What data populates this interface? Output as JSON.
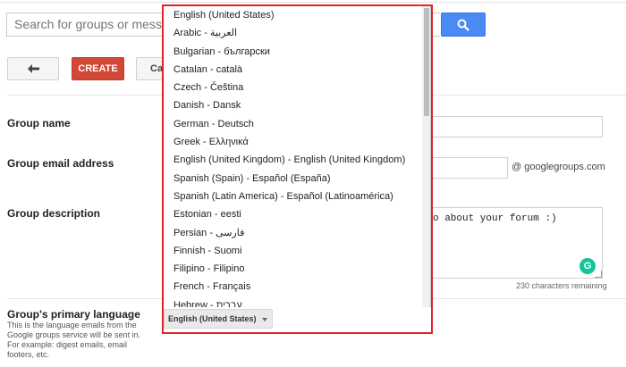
{
  "search": {
    "placeholder": "Search for groups or messag"
  },
  "toolbar": {
    "create_label": "CREATE",
    "cancel_label": "Cancel"
  },
  "form": {
    "name_label": "Group name",
    "email_label": "Group email address",
    "email_domain": "@ googlegroups.com",
    "description_label": "Group description",
    "description_value": "o about your forum :)",
    "char_count": "230 characters remaining",
    "language_label": "Group's primary language",
    "language_help": "This is the language emails from the Google groups service will be sent in. For example: digest emails, email footers, etc.",
    "language_selected": "English (United States)"
  },
  "language_options": [
    "English (United States)",
    "Arabic - العربية",
    "Bulgarian - български",
    "Catalan - català",
    "Czech - Čeština",
    "Danish - Dansk",
    "German - Deutsch",
    "Greek - Ελληνικά",
    "English (United Kingdom) - English (United Kingdom)",
    "Spanish (Spain) - Español (España)",
    "Spanish (Latin America) - Español (Latinoamérica)",
    "Estonian - eesti",
    "Persian - فارسی",
    "Finnish - Suomi",
    "Filipino - Filipino",
    "French - Français",
    "Hebrew - עברית"
  ],
  "icons": {
    "search": "search-icon",
    "back": "back-arrow-icon",
    "grammarly": "grammarly-icon",
    "caret": "chevron-down-icon"
  },
  "colors": {
    "search_button": "#4a8af4",
    "create_button": "#d14836",
    "highlight": "#e1232b",
    "grammarly": "#15c39a"
  }
}
